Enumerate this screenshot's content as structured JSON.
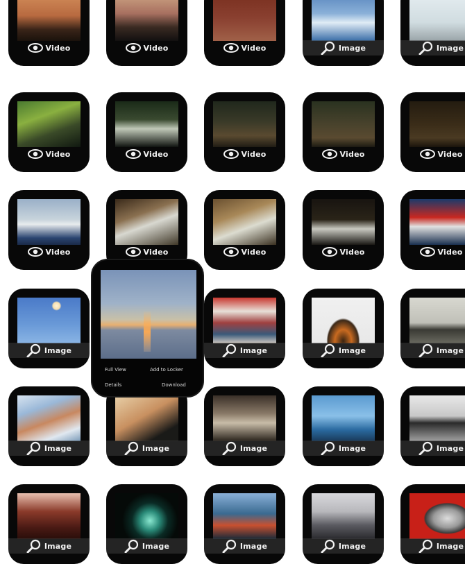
{
  "labels": {
    "video": "Video",
    "image": "Image"
  },
  "popup": {
    "full_view": "Full View",
    "add_to_locker": "Add to Locker",
    "details": "Details",
    "download": "Download"
  },
  "rows": [
    [
      "video",
      "video",
      "video",
      "image",
      "image"
    ],
    [
      "video",
      "video",
      "video",
      "video",
      "video"
    ],
    [
      "video",
      "video",
      "video",
      "video",
      "video"
    ],
    [
      "image",
      "image",
      "image",
      "image",
      "image"
    ],
    [
      "image",
      "image",
      "image",
      "image",
      "image"
    ],
    [
      "image",
      "image",
      "image",
      "image",
      "image"
    ]
  ],
  "colors": {
    "tile": "#080808",
    "label_text": "#f2f2f2",
    "background": "#ffffff"
  }
}
